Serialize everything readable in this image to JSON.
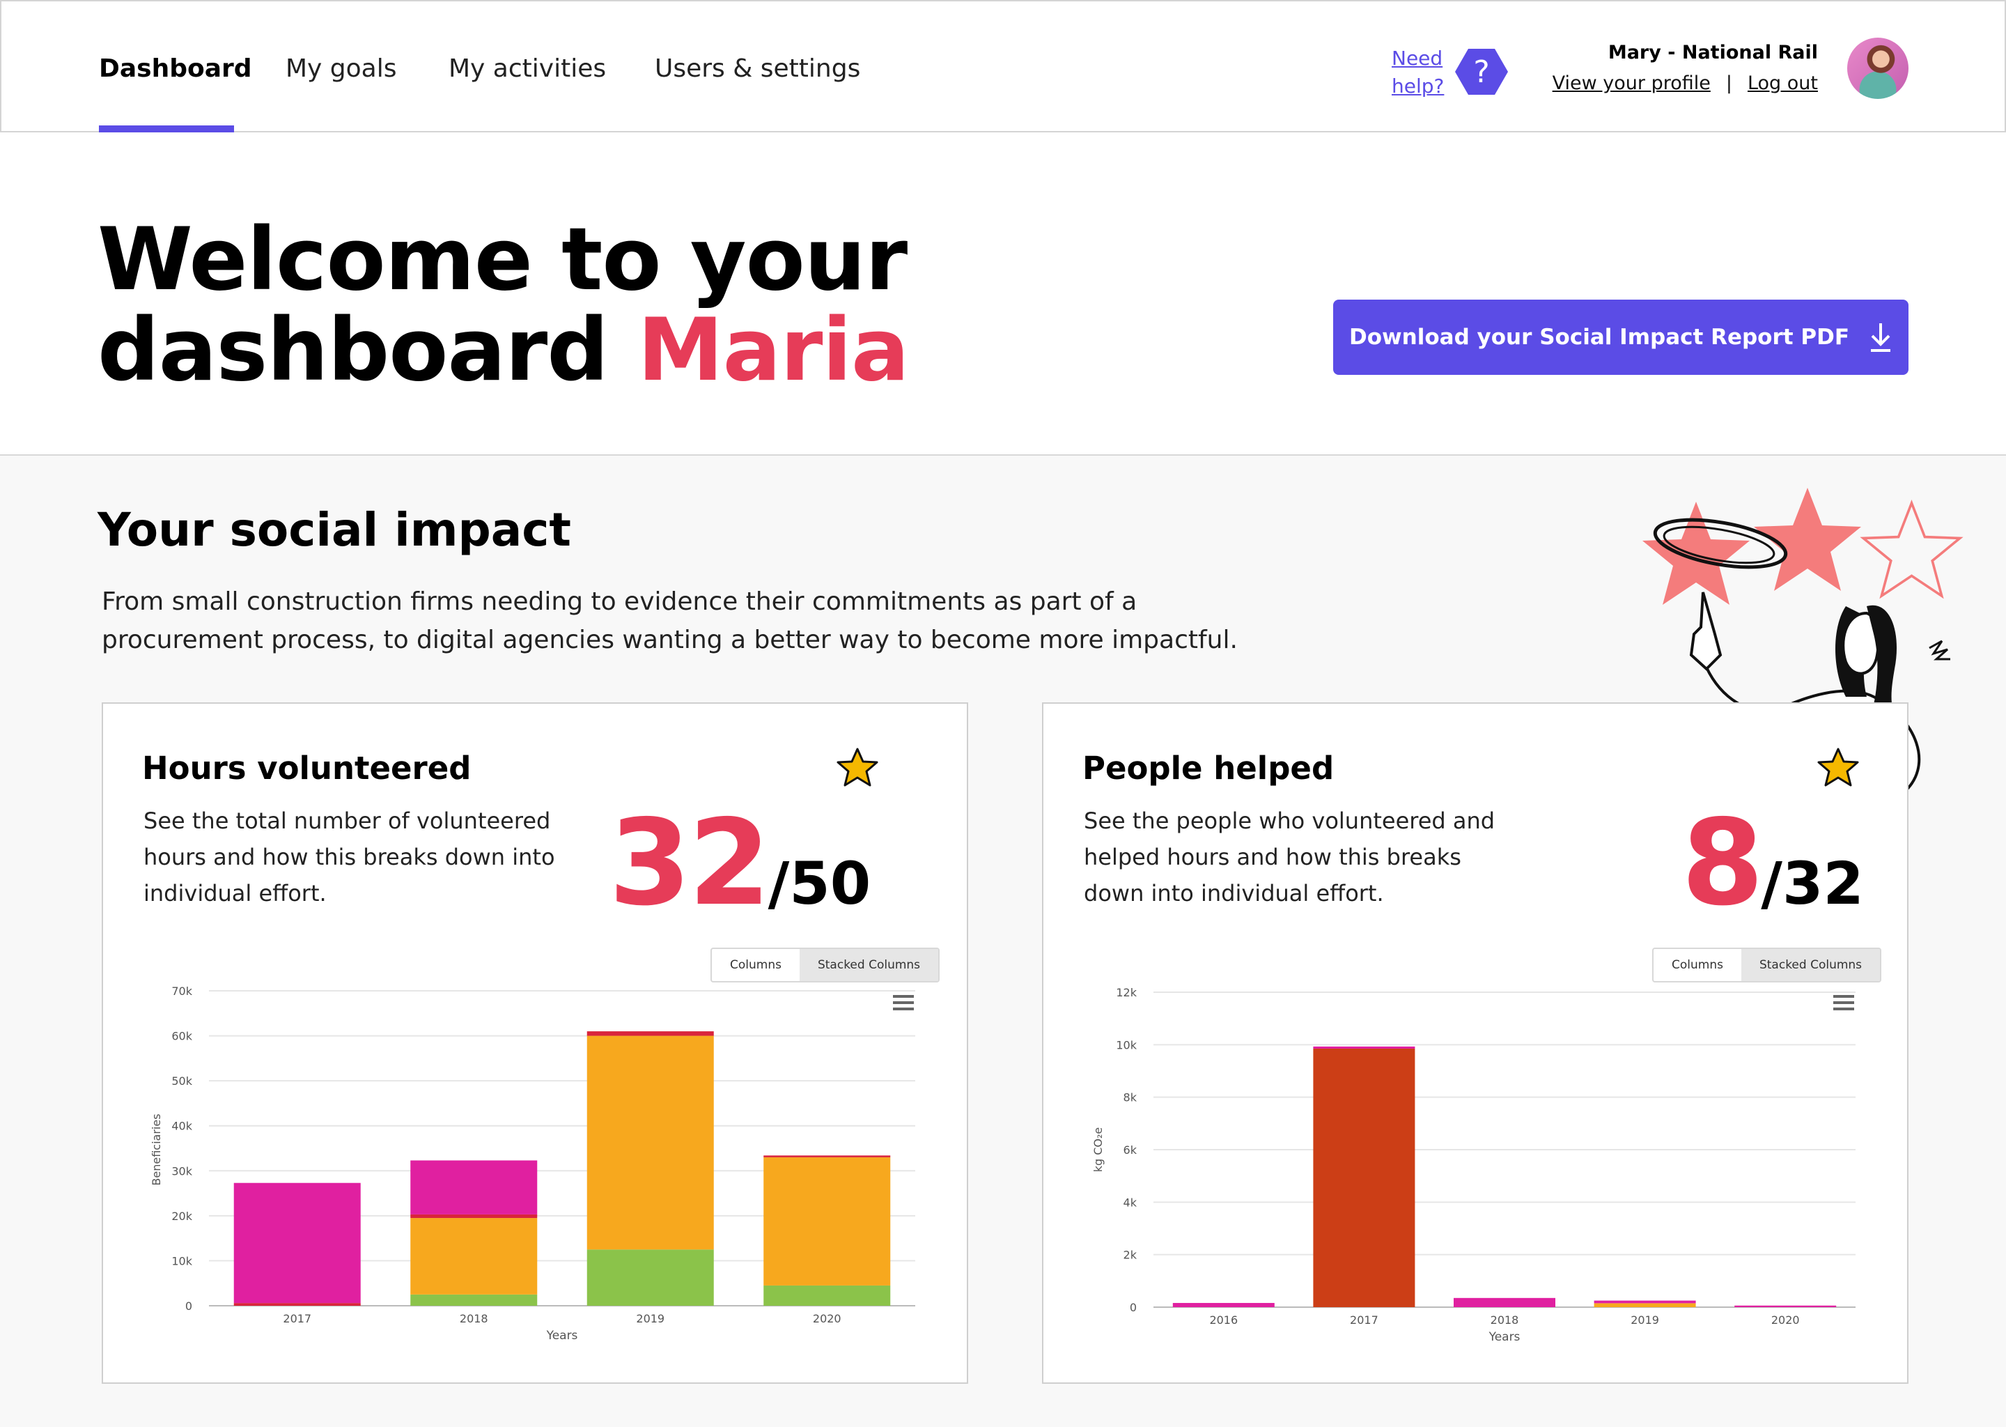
{
  "nav": {
    "items": [
      {
        "label": "Dashboard",
        "active": true
      },
      {
        "label": "My goals"
      },
      {
        "label": "My activities"
      },
      {
        "label": "Users & settings"
      }
    ],
    "help_label_line1": "Need",
    "help_label_line2": "help?",
    "help_icon": "question-icon",
    "user": {
      "name": "Mary - National Rail",
      "view_profile": "View your profile",
      "separator": "|",
      "logout": "Log out"
    }
  },
  "hero": {
    "title_line1": "Welcome to your",
    "title_line2": "dashboard",
    "name": "Maria",
    "download_label": "Download your Social Impact Report PDF",
    "download_icon": "download-icon"
  },
  "impact": {
    "title": "Your social impact",
    "description": "From small construction firms needing to evidence their commitments as part of a procurement process, to digital agencies wanting a better way to become more impactful."
  },
  "cards": [
    {
      "title": "Hours volunteered",
      "description": "See the total number of volunteered hours and how this breaks down into individual effort.",
      "value": "32",
      "total": "/50",
      "toggle": [
        "Columns",
        "Stacked Columns"
      ],
      "toggle_selected": "Stacked Columns"
    },
    {
      "title": "People helped",
      "description": "See the people who volunteered and helped hours and how this breaks down into individual effort.",
      "value": "8",
      "total": "/32",
      "toggle": [
        "Columns",
        "Stacked Columns"
      ],
      "toggle_selected": "Stacked Columns"
    }
  ],
  "colors": {
    "accent": "#5b4ce6",
    "highlight": "#e63c58",
    "star": "#f5b800",
    "green": "#8bc34a",
    "orange": "#f7a81e",
    "magenta": "#e020a0",
    "red": "#d9243c",
    "rust": "#cc3e16"
  },
  "chart_data": [
    {
      "type": "bar",
      "stacked": true,
      "categories": [
        "2017",
        "2018",
        "2019",
        "2020"
      ],
      "xlabel": "Years",
      "ylabel": "Beneficiaries",
      "ylim": [
        0,
        70000
      ],
      "yticks": [
        "0",
        "10k",
        "20k",
        "30k",
        "40k",
        "50k",
        "60k",
        "70k"
      ],
      "series": [
        {
          "color": "#8bc34a",
          "values": [
            0,
            2500,
            12500,
            4500
          ]
        },
        {
          "color": "#f7a81e",
          "values": [
            0,
            17000,
            47500,
            28500
          ]
        },
        {
          "color": "#d9243c",
          "values": [
            600,
            800,
            1000,
            400
          ]
        },
        {
          "color": "#e020a0",
          "values": [
            26700,
            12000,
            0,
            0
          ]
        }
      ]
    },
    {
      "type": "bar",
      "stacked": true,
      "categories": [
        "2016",
        "2017",
        "2018",
        "2019",
        "2020"
      ],
      "xlabel": "Years",
      "ylabel": "kg CO₂e",
      "ylim": [
        0,
        12000
      ],
      "yticks": [
        "0",
        "2k",
        "4k",
        "6k",
        "8k",
        "10k",
        "12k"
      ],
      "series": [
        {
          "color": "#f7a81e",
          "values": [
            0,
            0,
            0,
            150,
            0
          ]
        },
        {
          "color": "#cc3e16",
          "values": [
            0,
            9850,
            0,
            0,
            0
          ]
        },
        {
          "color": "#e020a0",
          "values": [
            160,
            80,
            350,
            100,
            60
          ]
        }
      ]
    }
  ]
}
